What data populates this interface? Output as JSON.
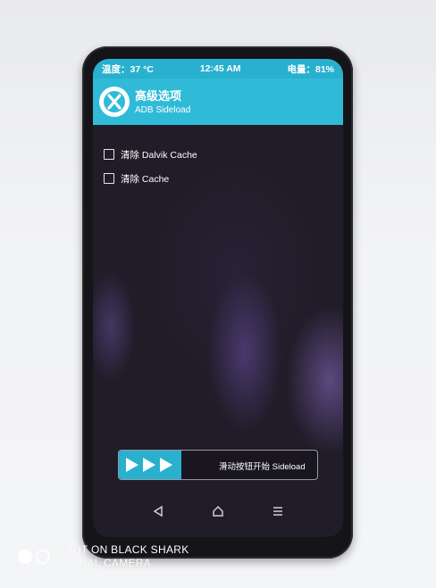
{
  "status_bar": {
    "temperature": "温度：37 °C",
    "time": "12:45 AM",
    "battery": "电量：81%"
  },
  "header": {
    "title": "高级选项",
    "subtitle": "ADB Sideload",
    "logo_icon": "twrp-logo-icon"
  },
  "options": [
    {
      "label": "清除 Dalvik Cache",
      "checked": false
    },
    {
      "label": "清除 Cache",
      "checked": false
    }
  ],
  "slider": {
    "label": "滑动按钮开始 Sideload",
    "icon": "triple-arrow-icon"
  },
  "navbar": {
    "back_icon": "back-triangle-icon",
    "home_icon": "home-icon",
    "menu_icon": "menu-icon"
  },
  "watermark": {
    "line1": "SHOT ON BLACK SHARK",
    "line2": "AI DUAL CAMERA"
  },
  "colors": {
    "accent": "#2fbad8",
    "status_bar": "#29b0cf",
    "background": "#201c28"
  }
}
